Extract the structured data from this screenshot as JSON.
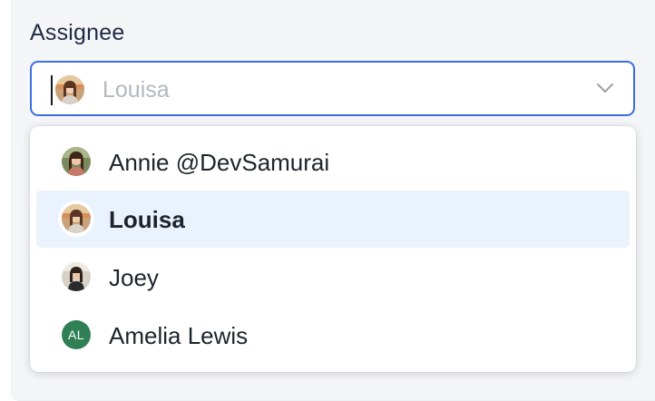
{
  "field": {
    "label": "Assignee"
  },
  "select": {
    "value": "Louisa",
    "avatar": "user-photo-louisa"
  },
  "options": [
    {
      "label": "Annie @DevSamurai",
      "avatar": "user-photo-annie",
      "selected": false
    },
    {
      "label": "Louisa",
      "avatar": "user-photo-louisa",
      "selected": true
    },
    {
      "label": "Joey",
      "avatar": "user-photo-joey",
      "selected": false
    },
    {
      "label": "Amelia Lewis",
      "avatar_initials": "AL",
      "avatar_color": "#2f8155",
      "selected": false
    }
  ],
  "colors": {
    "focus_border": "#3b6fe0",
    "selected_background": "#e9f2fd",
    "placeholder_text": "#b3b7bf"
  },
  "icons": {
    "dropdown": "chevron-down-icon"
  }
}
